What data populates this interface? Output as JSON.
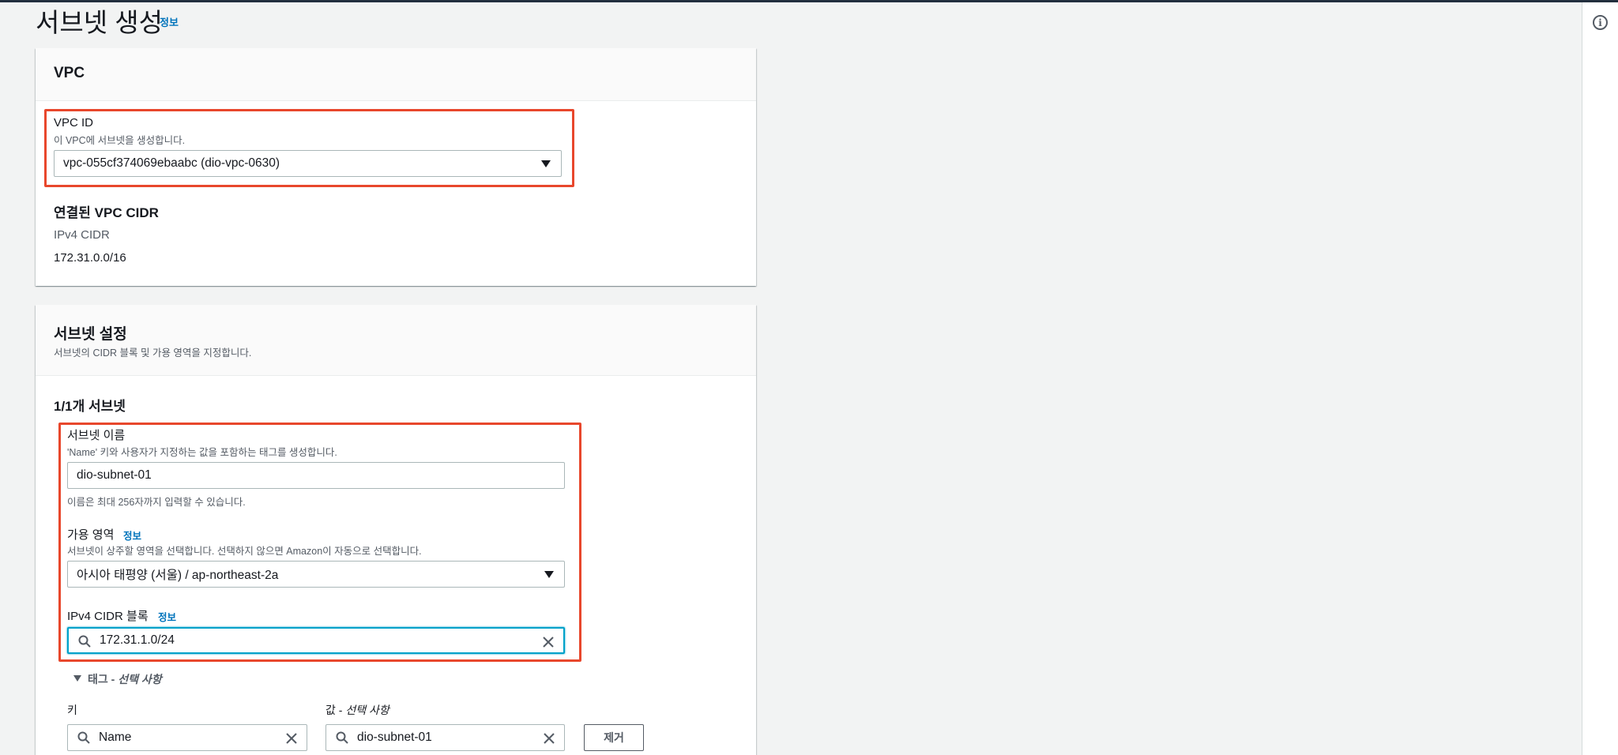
{
  "page": {
    "title": "서브넷 생성",
    "info_link": "정보"
  },
  "vpc_panel": {
    "title": "VPC",
    "vpc_id_label": "VPC ID",
    "vpc_id_desc": "이 VPC에 서브넷을 생성합니다.",
    "vpc_id_value": "vpc-055cf374069ebaabc (dio-vpc-0630)",
    "cidr_title": "연결된 VPC CIDR",
    "cidr_type": "IPv4 CIDR",
    "cidr_value": "172.31.0.0/16"
  },
  "subnet_panel": {
    "title": "서브넷 설정",
    "desc": "서브넷의 CIDR 블록 및 가용 영역을 지정합니다.",
    "count_title": "1/1개 서브넷",
    "name_label": "서브넷 이름",
    "name_desc": "'Name' 키와 사용자가 지정하는 값을 포함하는 태그를 생성합니다.",
    "name_value": "dio-subnet-01",
    "name_hint": "이름은 최대 256자까지 입력할 수 있습니다.",
    "az_label": "가용 영역",
    "az_info": "정보",
    "az_desc": "서브넷이 상주할 영역을 선택합니다. 선택하지 않으면 Amazon이 자동으로 선택합니다.",
    "az_value": "아시아 태평양 (서울) / ap-northeast-2a",
    "cidr_label": "IPv4 CIDR 블록",
    "cidr_info": "정보",
    "cidr_value": "172.31.1.0/24",
    "tags_toggle": "태그 - ",
    "tags_optional": "선택 사항",
    "key_label": "키",
    "value_label": "값 - ",
    "value_optional": "선택 사항",
    "tag_key": "Name",
    "tag_value": "dio-subnet-01",
    "remove_button": "제거"
  },
  "colors": {
    "highlight": "#e8472c",
    "link": "#0073bb",
    "focus": "#00a1c9"
  }
}
